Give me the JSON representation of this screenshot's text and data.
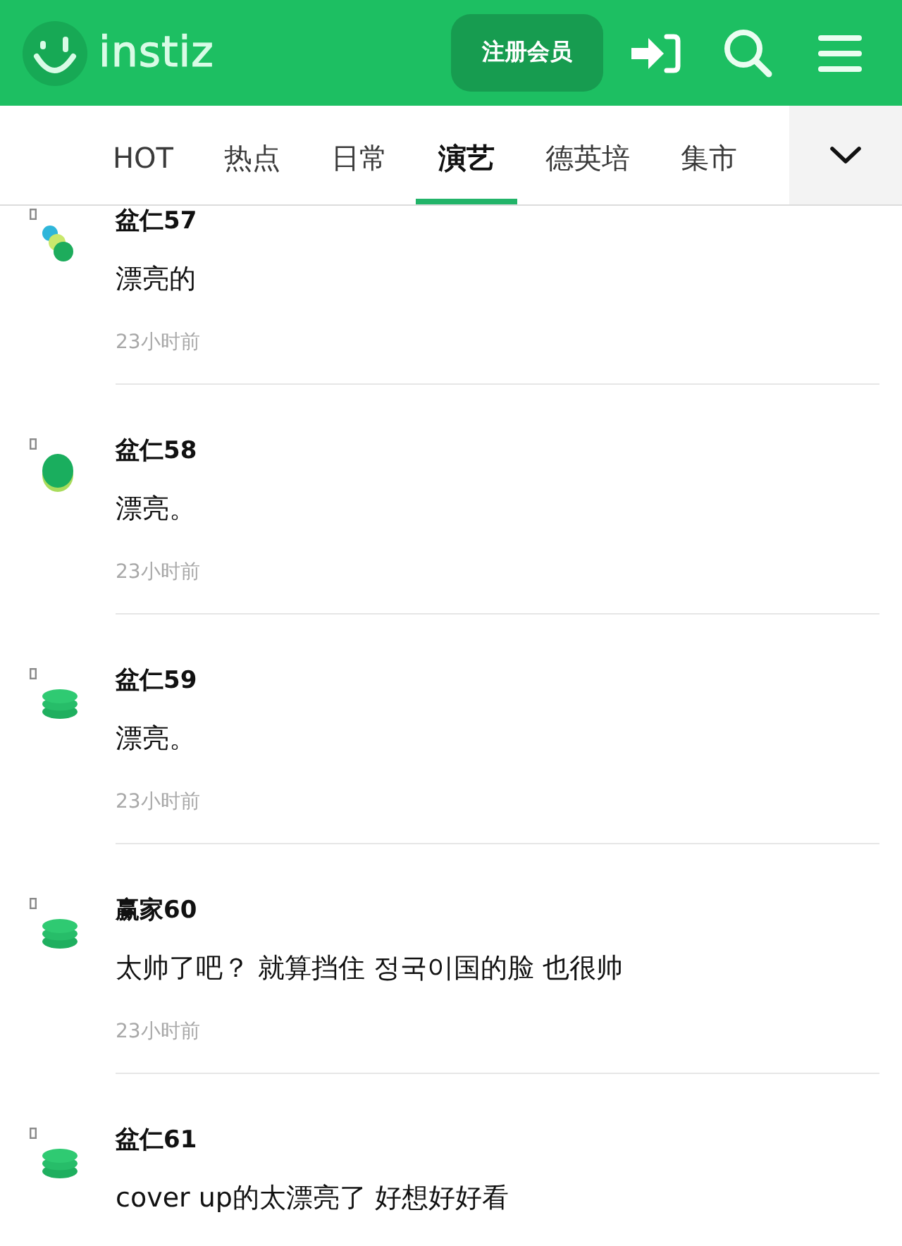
{
  "header": {
    "logo": "instiz",
    "signup_button": "注册会员"
  },
  "tabs": [
    {
      "label": "HOT",
      "selected": false
    },
    {
      "label": "热点",
      "selected": false
    },
    {
      "label": "日常",
      "selected": false
    },
    {
      "label": "演艺",
      "selected": true
    },
    {
      "label": "德英培",
      "selected": false
    },
    {
      "label": "集市",
      "selected": false
    }
  ],
  "comments": [
    {
      "kind": "circles",
      "author": "盆仁57",
      "text": "漂亮的",
      "time": "23小时前"
    },
    {
      "kind": "disc",
      "author": "盆仁58",
      "text": "漂亮。",
      "time": "23小时前"
    },
    {
      "kind": "stack",
      "author": "盆仁59",
      "text": "漂亮。",
      "time": "23小时前"
    },
    {
      "kind": "stack",
      "author": "赢家60",
      "text": "太帅了吧？ 就算挡住 정국이国的脸 也很帅",
      "time": "23小时前"
    },
    {
      "kind": "stack",
      "author": "盆仁61",
      "text": "cover up的太漂亮了 好想好好看"
    }
  ]
}
